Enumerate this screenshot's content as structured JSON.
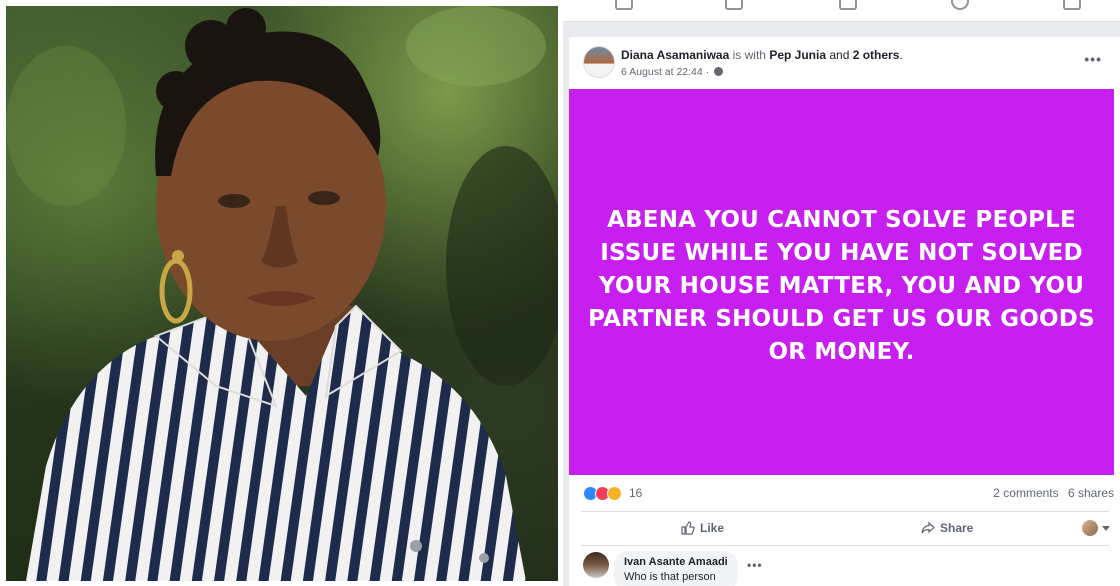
{
  "photo": {
    "colors": {
      "foliage": "#3f5a2d",
      "skin": "#7b4a2c",
      "shirt_stripe": "#1f2b4a",
      "shirt_base": "#f1f1f1",
      "earring": "#c9a646"
    }
  },
  "post": {
    "author": "Diana Asamaniwaa",
    "with_word": "is with",
    "tagged": "Pep Junia",
    "and_word": "and",
    "others": "2 others",
    "timestamp": "6 August at 22:44 ·",
    "audience_icon": "globe-icon",
    "banner": {
      "text": "ABENA YOU CANNOT SOLVE PEOPLE ISSUE WHILE YOU HAVE NOT SOLVED YOUR HOUSE MATTER, YOU AND YOU PARTNER SHOULD GET US OUR GOODS OR MONEY.",
      "background": "#c71fef"
    },
    "reactions": {
      "icons": [
        "like-reaction-icon",
        "love-reaction-icon",
        "wow-reaction-icon"
      ],
      "count": "16"
    },
    "comments_count": "2 comments",
    "shares_count": "6 shares",
    "actions": {
      "like_label": "Like",
      "share_label": "Share"
    }
  },
  "comment": {
    "author": "Ivan Asante Amaadi",
    "text": "Who is that person"
  }
}
